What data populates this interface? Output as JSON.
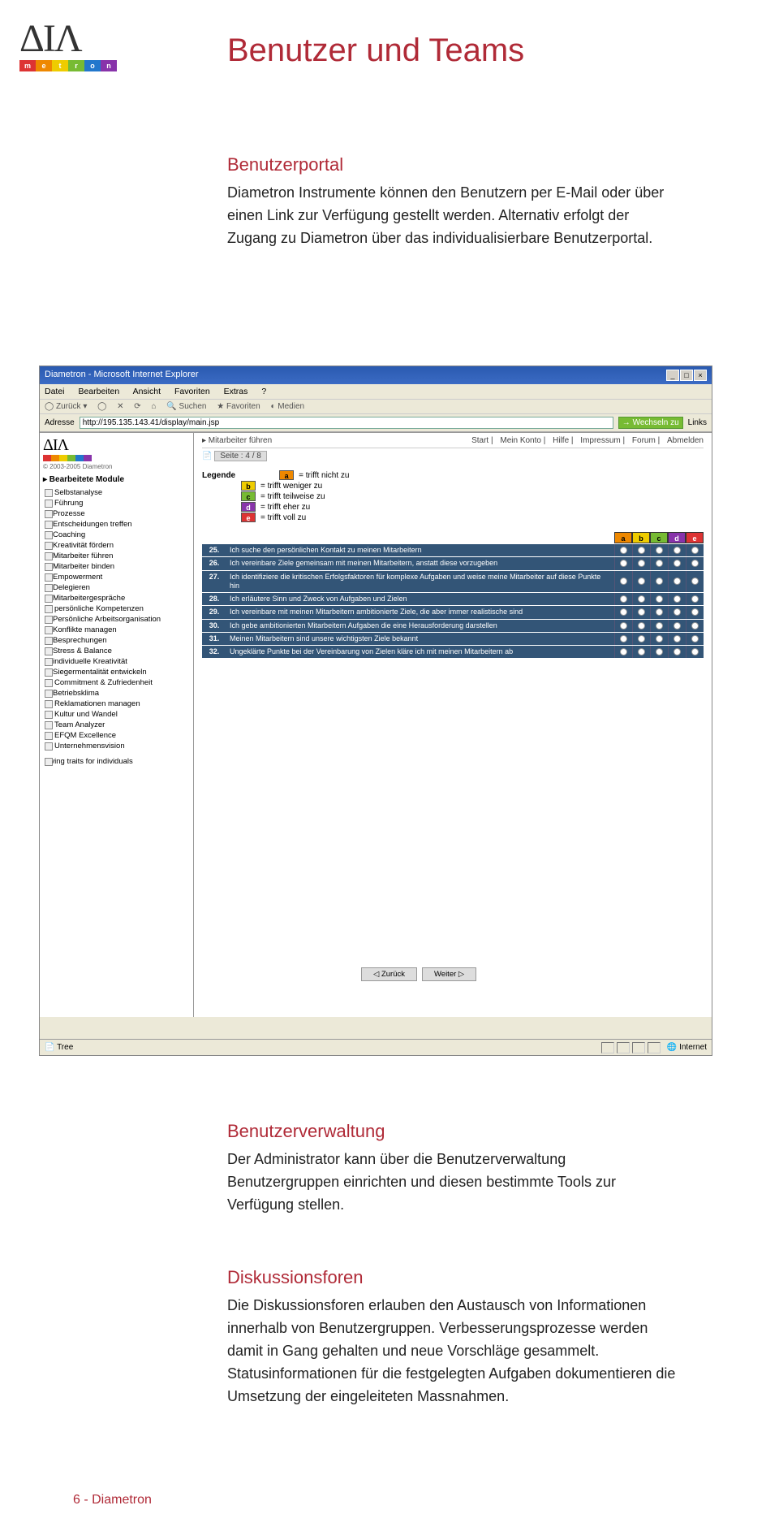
{
  "logo": {
    "letters": "ΔΙΛ",
    "word_split": [
      "m",
      "e",
      "t",
      "r",
      "o",
      "n"
    ]
  },
  "page": {
    "title": "Benutzer und Teams",
    "sections": {
      "portal": {
        "heading": "Benutzerportal",
        "body": "Diametron Instrumente können den Benutzern per E-Mail oder über einen Link zur Verfügung gestellt werden. Alternativ erfolgt der Zugang zu Diametron über das individualisierbare Benutzerportal."
      },
      "verwaltung": {
        "heading": "Benutzerverwaltung",
        "body": "Der Administrator kann über die Benutzerverwaltung Benutzergruppen einrichten und diesen bestimmte Tools zur Verfügung stellen."
      },
      "foren": {
        "heading": "Diskussionsforen",
        "body": "Die Diskussionsforen erlauben den Austausch von Informationen innerhalb von Benutzergruppen. Verbesserungsprozesse werden damit in Gang gehalten und neue Vorschläge gesammelt. Statusinformationen für die festgelegten Aufgaben dokumentieren die Umsetzung der eingeleiteten Massnahmen."
      }
    }
  },
  "screenshot": {
    "window_title": "Diametron - Microsoft Internet Explorer",
    "menu": [
      "Datei",
      "Bearbeiten",
      "Ansicht",
      "Favoriten",
      "Extras",
      "?"
    ],
    "toolbar": [
      "Zurück",
      "Suchen",
      "Favoriten",
      "Medien"
    ],
    "address_label": "Adresse",
    "address_value": "http://195.135.143.41/display/main.jsp",
    "go_label": "Wechseln zu",
    "links_label": "Links",
    "sidebar": {
      "copyright": "© 2003-2005 Diametron",
      "module_head": "▸ Bearbeitete Module",
      "tree": [
        {
          "label": "Selbstanalyse",
          "sub": []
        },
        {
          "label": "Führung",
          "sub": [
            "Prozesse",
            "Entscheidungen treffen",
            "Coaching",
            "Kreativität fördern",
            "Mitarbeiter führen",
            "Mitarbeiter binden",
            "Empowerment",
            "Delegieren",
            "Mitarbeitergespräche"
          ]
        },
        {
          "label": "persönliche Kompetenzen",
          "sub": [
            "Persönliche Arbeitsorganisation",
            "Konflikte managen",
            "Besprechungen",
            "Stress & Balance",
            "individuelle Kreativität",
            "Siegermentalität entwickeln"
          ]
        },
        {
          "label": "Commitment & Zufriedenheit",
          "sub": [
            "Betriebsklima"
          ]
        },
        {
          "label": "Reklamationen managen",
          "sub": []
        },
        {
          "label": "Kultur und Wandel",
          "sub": []
        },
        {
          "label": "Team Analyzer",
          "sub": []
        },
        {
          "label": "EFQM Excellence",
          "sub": []
        },
        {
          "label": "Unternehmensvision",
          "sub": []
        }
      ],
      "footer_item": "Living traits for individuals"
    },
    "crumb": {
      "path": "▸ Mitarbeiter führen",
      "links": [
        "Start",
        "Mein Konto",
        "Hilfe",
        "Impressum",
        "Forum",
        "Abmelden"
      ]
    },
    "page_indicator": "Seite : 4 / 8",
    "legend": {
      "label": "Legende",
      "items": [
        {
          "k": "a",
          "txt": "= trifft nicht zu"
        },
        {
          "k": "b",
          "txt": "= trifft weniger zu"
        },
        {
          "k": "c",
          "txt": "= trifft teilweise zu"
        },
        {
          "k": "d",
          "txt": "= trifft eher zu"
        },
        {
          "k": "e",
          "txt": "= trifft voll zu"
        }
      ]
    },
    "table_head": [
      "a",
      "b",
      "c",
      "d",
      "e"
    ],
    "questions": [
      {
        "n": "25.",
        "t": "Ich suche den persönlichen Kontakt zu meinen Mitarbeitern"
      },
      {
        "n": "26.",
        "t": "Ich vereinbare Ziele gemeinsam mit meinen Mitarbeitern, anstatt diese vorzugeben"
      },
      {
        "n": "27.",
        "t": "Ich identifiziere die kritischen Erfolgsfaktoren für komplexe Aufgaben und weise meine Mitarbeiter auf diese Punkte hin"
      },
      {
        "n": "28.",
        "t": "Ich erläutere Sinn und Zweck von Aufgaben und Zielen"
      },
      {
        "n": "29.",
        "t": "Ich vereinbare mit meinen Mitarbeitern ambitionierte Ziele, die aber immer realistische sind"
      },
      {
        "n": "30.",
        "t": "Ich gebe ambitionierten Mitarbeitern Aufgaben die eine Herausforderung darstellen"
      },
      {
        "n": "31.",
        "t": "Meinen Mitarbeitern sind unsere wichtigsten Ziele bekannt"
      },
      {
        "n": "32.",
        "t": "Ungeklärte Punkte bei der Vereinbarung von Zielen kläre ich mit meinen Mitarbeitern ab"
      }
    ],
    "nav": {
      "back": "◁ Zurück",
      "forward": "Weiter ▷"
    },
    "status": {
      "left": "Tree",
      "right": "Internet"
    }
  },
  "footer": "6 - Diametron"
}
